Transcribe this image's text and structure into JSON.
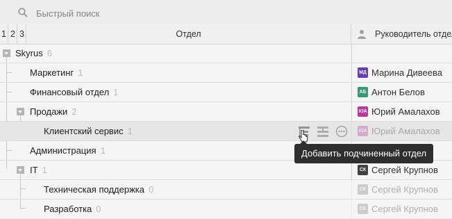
{
  "search": {
    "placeholder": "Быстрый поиск"
  },
  "header": {
    "levels": [
      "1",
      "2",
      "3"
    ],
    "department": "Отдел",
    "lead": "Руководитель отдела"
  },
  "rows": [
    {
      "name": "Skyrus",
      "count": "6",
      "lead": ""
    },
    {
      "name": "Маркетинг",
      "count": "1",
      "lead": "Марина Дивеева",
      "initials": "МД",
      "color": "#6a3fc0"
    },
    {
      "name": "Финансовый отдел",
      "count": "1",
      "lead": "Антон Белов",
      "initials": "АБ",
      "color": "#3aa07a"
    },
    {
      "name": "Продажи",
      "count": "2",
      "lead": "Юрий Амалахов",
      "initials": "ЮА",
      "color": "#c43aa5"
    },
    {
      "name": "Клиентский сервис",
      "count": "1",
      "lead": "Юрий Амалахов",
      "initials": "ЮА",
      "color": "#c43aa5"
    },
    {
      "name": "Администрация",
      "count": "1",
      "lead": ""
    },
    {
      "name": "IT",
      "count": "1",
      "lead": "Сергей Крупнов",
      "initials": "СК",
      "color": "#444444"
    },
    {
      "name": "Техническая поддержка",
      "count": "0",
      "lead": "Сергей Крупнов",
      "initials": "СК",
      "color": "#888888"
    },
    {
      "name": "Разработка",
      "count": "0",
      "lead": "Сергей Крупнов",
      "initials": "СК",
      "color": "#888888"
    }
  ],
  "tooltip": {
    "text": "Добавить подчиненный отдел"
  },
  "icons": {
    "search": "search-icon",
    "person": "person-icon",
    "add_child": "add-subdepartment-icon",
    "move": "move-department-icon",
    "more": "more-options-icon"
  }
}
